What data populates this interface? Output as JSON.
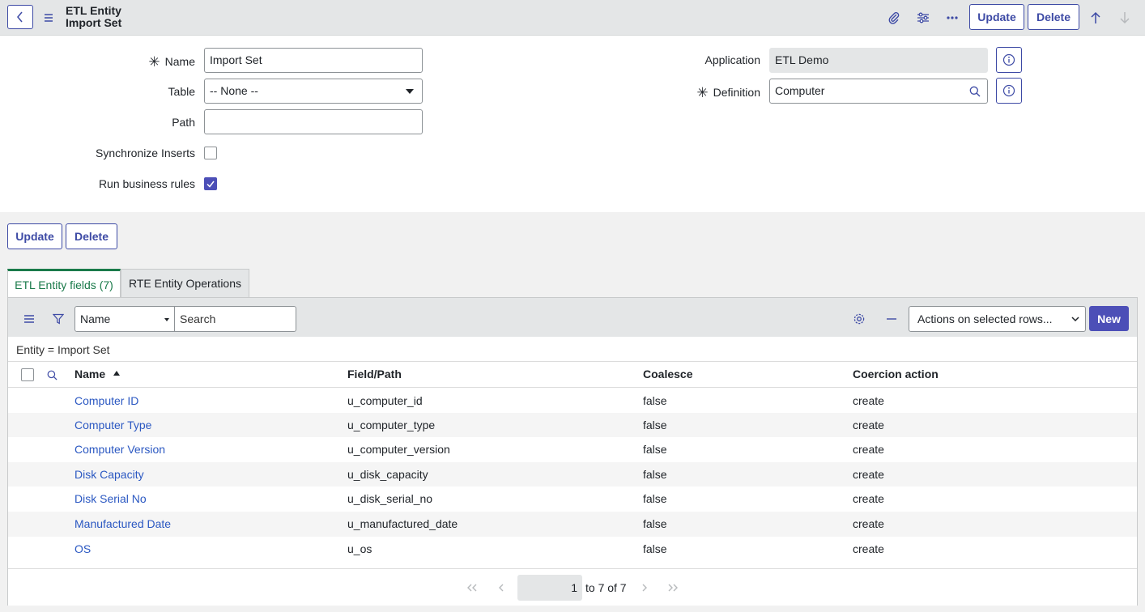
{
  "header": {
    "title_line1": "ETL Entity",
    "title_line2": "Import Set",
    "update_label": "Update",
    "delete_label": "Delete"
  },
  "form": {
    "name": {
      "label": "Name",
      "value": "Import Set"
    },
    "table": {
      "label": "Table",
      "value": "-- None --"
    },
    "path": {
      "label": "Path",
      "value": ""
    },
    "synchronize_inserts": {
      "label": "Synchronize Inserts",
      "checked": false
    },
    "run_business_rules": {
      "label": "Run business rules",
      "checked": true
    },
    "application": {
      "label": "Application",
      "value": "ETL Demo"
    },
    "definition": {
      "label": "Definition",
      "value": "Computer"
    }
  },
  "form_buttons": {
    "update_label": "Update",
    "delete_label": "Delete"
  },
  "tabs": [
    {
      "label": "ETL Entity fields (7)",
      "active": true
    },
    {
      "label": "RTE Entity Operations",
      "active": false
    }
  ],
  "list": {
    "search_field": "Name",
    "search_placeholder": "Search",
    "actions_label": "Actions on selected rows...",
    "new_label": "New",
    "breadcrumb": "Entity = Import Set",
    "columns": [
      "Name",
      "Field/Path",
      "Coalesce",
      "Coercion action"
    ],
    "rows": [
      [
        "Computer ID",
        "u_computer_id",
        "false",
        "create"
      ],
      [
        "Computer Type",
        "u_computer_type",
        "false",
        "create"
      ],
      [
        "Computer Version",
        "u_computer_version",
        "false",
        "create"
      ],
      [
        "Disk Capacity",
        "u_disk_capacity",
        "false",
        "create"
      ],
      [
        "Disk Serial No",
        "u_disk_serial_no",
        "false",
        "create"
      ],
      [
        "Manufactured Date",
        "u_manufactured_date",
        "false",
        "create"
      ],
      [
        "OS",
        "u_os",
        "false",
        "create"
      ]
    ],
    "pager": {
      "current": "1",
      "range_text": "to 7 of 7"
    }
  },
  "colors": {
    "accent": "#3d4aa5",
    "primary_button": "#4c4fb7",
    "link": "#2b58c2",
    "active_tab": "#1a7a4a"
  }
}
